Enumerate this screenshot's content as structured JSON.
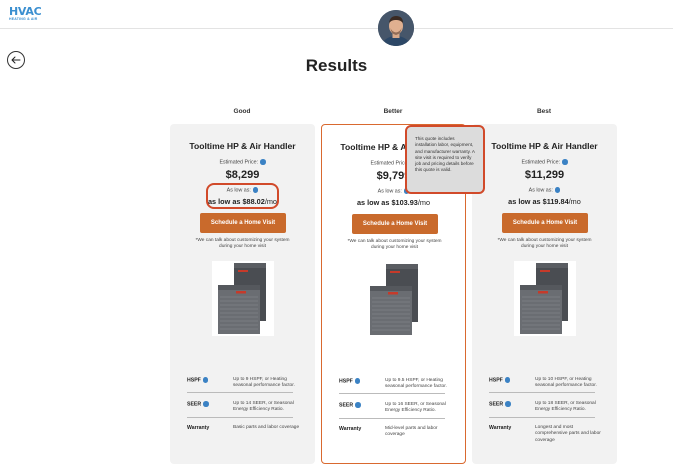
{
  "header": {
    "logo_main": "HVAC",
    "logo_sub": "HEATING & AIR"
  },
  "page": {
    "title": "Results"
  },
  "tiers": [
    {
      "label": "Good",
      "title": "Tooltime HP & Air Handler",
      "estimated_label": "Estimated Price:",
      "price": "$8,299",
      "as_low_label": "As low as:",
      "monthly_prefix": "as low as ",
      "monthly_amount": "$88.02",
      "monthly_suffix": "/mo",
      "cta_label": "Schedule a Home Visit",
      "cta_note": "*We can talk about customizing your system during your home visit",
      "specs": [
        {
          "name": "HSPF",
          "value": "Up to 9 HSPF, or Heating seasonal performance factor."
        },
        {
          "name": "SEER",
          "value": "Up to 14 SEER, or Seasonal Energy Efficiency Ratio."
        },
        {
          "name": "Warranty",
          "value": "Basic parts and labor coverage"
        }
      ]
    },
    {
      "label": "Better",
      "title": "Tooltime HP & Air Handler",
      "estimated_label": "Estimated Price:",
      "price": "$9,799",
      "as_low_label": "As low as:",
      "monthly_prefix": "as low as ",
      "monthly_amount": "$103.93",
      "monthly_suffix": "/mo",
      "cta_label": "Schedule a Home Visit",
      "cta_note": "*We can talk about customizing your system during your home visit",
      "specs": [
        {
          "name": "HSPF",
          "value": "Up to 9.5 HSPF, or Heating seasonal performance factor."
        },
        {
          "name": "SEER",
          "value": "Up to 16 SEER, or Seasonal Energy Efficiency Ratio."
        },
        {
          "name": "Warranty",
          "value": "Mid-level parts and labor coverage"
        }
      ]
    },
    {
      "label": "Best",
      "title": "Tooltime HP & Air Handler",
      "estimated_label": "Estimated Price:",
      "price": "$11,299",
      "as_low_label": "As low as:",
      "monthly_prefix": "as low as ",
      "monthly_amount": "$119.84",
      "monthly_suffix": "/mo",
      "cta_label": "Schedule a Home Visit",
      "cta_note": "*We can talk about customizing your system during your home visit",
      "specs": [
        {
          "name": "HSPF",
          "value": "Up to 10 HSPF, or Heating seasonal performance factor."
        },
        {
          "name": "SEER",
          "value": "Up to 18 SEER, or Seasonal Energy Efficiency Ratio."
        },
        {
          "name": "Warranty",
          "value": "Longest and most comprehensive parts and labor coverage"
        }
      ]
    }
  ],
  "tooltip": {
    "text": "This quote includes installation labor, equipment, and manufacturer warranty. A site visit is required to verify job and pricing details before this quote is valid."
  },
  "colors": {
    "accent": "#c96a2c",
    "highlight": "#d14a2a",
    "info": "#3b82c4",
    "logo": "#3b8fd0"
  }
}
